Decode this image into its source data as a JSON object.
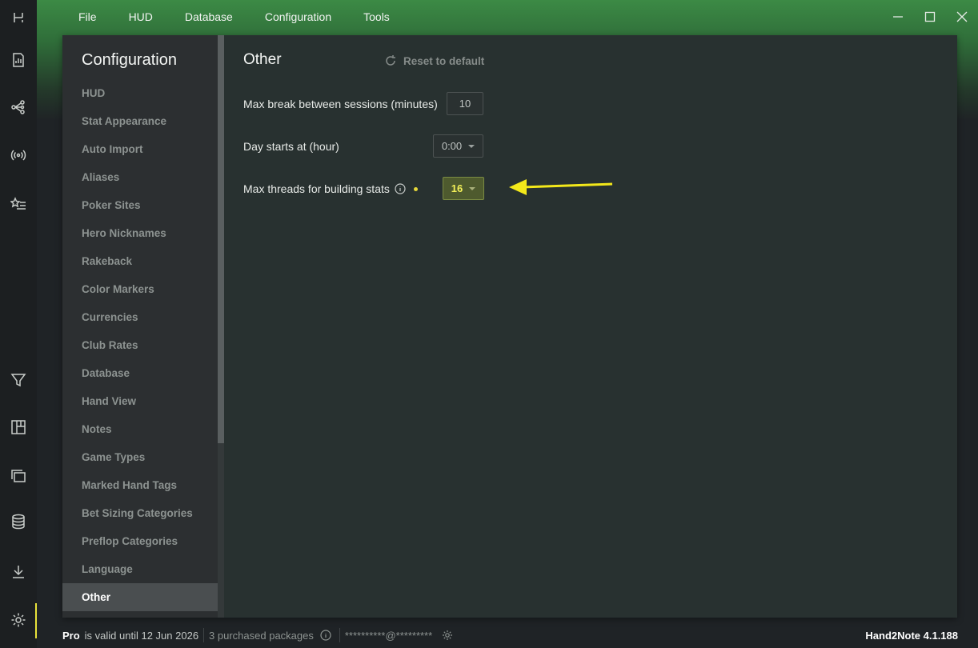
{
  "menu": [
    "File",
    "HUD",
    "Database",
    "Configuration",
    "Tools"
  ],
  "rail_icons": [
    "logo-icon",
    "report-icon",
    "graph-icon",
    "broadcast-icon",
    "star-list-icon",
    "filter-icon",
    "layout-icon",
    "windows-icon",
    "database-icon",
    "download-icon",
    "settings-icon"
  ],
  "sidebar": {
    "title": "Configuration",
    "items": [
      "HUD",
      "Stat Appearance",
      "Auto Import",
      "Aliases",
      "Poker Sites",
      "Hero Nicknames",
      "Rakeback",
      "Color Markers",
      "Currencies",
      "Club Rates",
      "Database",
      "Hand View",
      "Notes",
      "Game Types",
      "Marked Hand Tags",
      "Bet Sizing Categories",
      "Preflop Categories",
      "Language",
      "Other"
    ],
    "active": "Other"
  },
  "content": {
    "title": "Other",
    "reset_label": "Reset to default",
    "settings": {
      "max_break_label": "Max break between sessions (minutes)",
      "max_break_value": "10",
      "day_start_label": "Day starts at (hour)",
      "day_start_value": "0:00",
      "threads_label": "Max threads for building stats",
      "threads_value": "16"
    }
  },
  "status": {
    "plan": "Pro",
    "valid_text": "is valid until 12 Jun 2026",
    "packages": "3 purchased packages",
    "account": "**********@*********",
    "version": "Hand2Note 4.1.188"
  },
  "colors": {
    "accent": "#e8e23a",
    "brand_green": "#3c8a45",
    "highlight_field": "#4e5a2e"
  }
}
